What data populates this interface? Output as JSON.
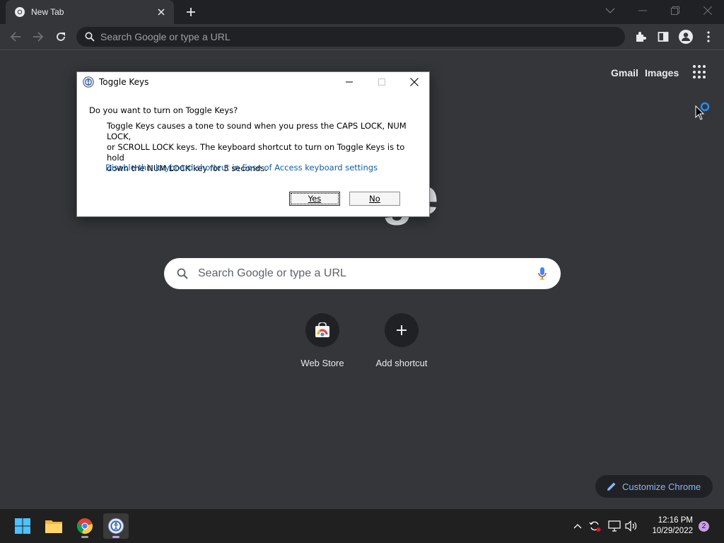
{
  "browser": {
    "tab": {
      "title": "New Tab"
    },
    "omnibox": {
      "placeholder": "Search Google or type a URL"
    }
  },
  "ntp": {
    "links": [
      "Gmail",
      "Images"
    ],
    "logo_fragment": "ge",
    "search_placeholder": "Search Google or type a URL",
    "shortcuts": [
      {
        "label": "Web Store",
        "icon": "web-store-icon"
      },
      {
        "label": "Add shortcut",
        "icon": "plus-icon"
      }
    ],
    "customize_label": "Customize Chrome"
  },
  "dialog": {
    "title": "Toggle Keys",
    "question": "Do you want to turn on Toggle Keys?",
    "body_line1": "Toggle Keys causes a tone to sound when you press the CAPS LOCK, NUM LOCK,",
    "body_line2": "or SCROLL LOCK keys.  The keyboard shortcut to turn on Toggle Keys is to hold",
    "body_line3": "down the NUM LOCK key for 5 seconds.",
    "link": "Disable this keyboard shortcut in Ease of Access keyboard settings",
    "yes_label": "Yes",
    "no_label": "No"
  },
  "taskbar": {
    "apps": [
      "windows-start-icon",
      "file-explorer-icon",
      "chrome-icon",
      "ease-of-access-icon"
    ],
    "time": "12:16 PM",
    "date": "10/29/2022",
    "notification_count": "2"
  },
  "colors": {
    "background": "#35363a",
    "accent_link": "#8ab4f8",
    "dialog_link": "#0f5ea8"
  }
}
